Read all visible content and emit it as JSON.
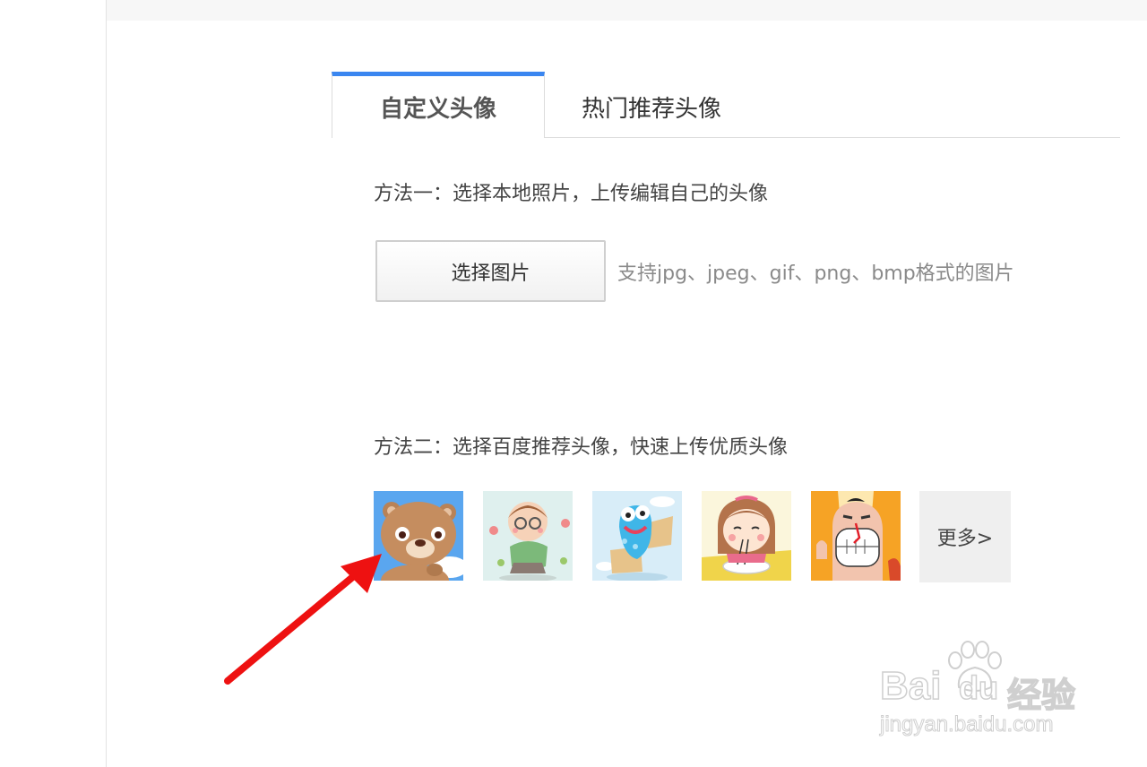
{
  "tabs": {
    "custom_avatar": "自定义头像",
    "popular_avatar": "热门推荐头像"
  },
  "method_one": {
    "title": "方法一：选择本地照片，上传编辑自己的头像",
    "button_label": "选择图片",
    "hint": "支持jpg、jpeg、gif、png、bmp格式的图片"
  },
  "method_two": {
    "title": "方法二：选择百度推荐头像，快速上传优质头像",
    "avatars": [
      {
        "icon": "bear-avatar-icon",
        "bg": "#5aa6ef"
      },
      {
        "icon": "glasses-boy-avatar-icon",
        "bg": "#dff0ee"
      },
      {
        "icon": "blue-monster-avatar-icon",
        "bg": "#d8edf8"
      },
      {
        "icon": "eating-girl-avatar-icon",
        "bg": "#fbf6dc"
      },
      {
        "icon": "grinning-man-avatar-icon",
        "bg": "#f6a325"
      }
    ],
    "more_label": "更多>"
  },
  "annotation": {
    "arrow_color": "#ee1111"
  },
  "watermark": {
    "brand": "Bai",
    "brand2": "du",
    "suffix": "经验",
    "url": "jingyan.baidu.com"
  },
  "colors": {
    "tab_accent": "#3a86f0",
    "border": "#dcdcdc"
  }
}
